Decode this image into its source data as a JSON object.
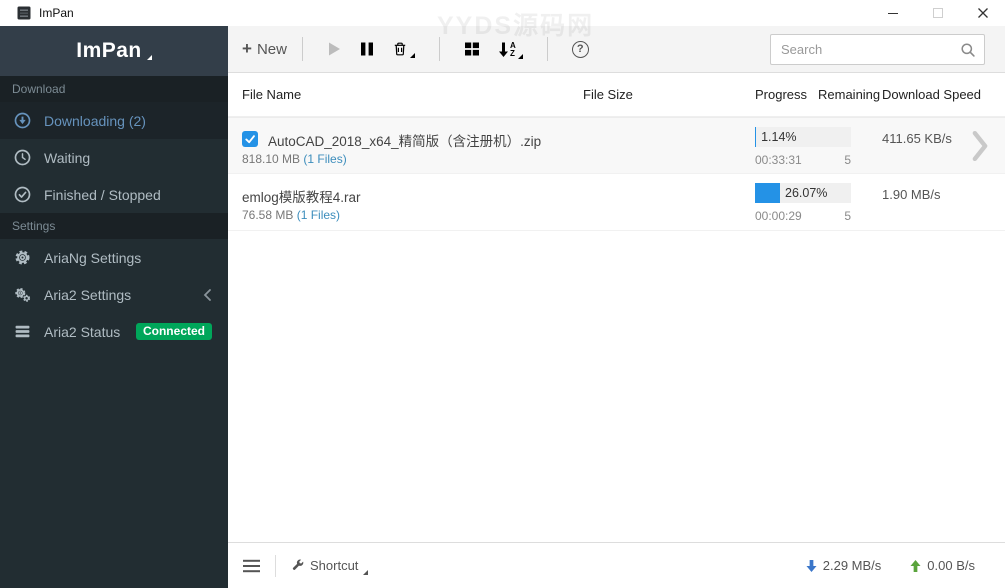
{
  "window": {
    "title": "ImPan"
  },
  "watermark": "YYDS源码网",
  "sidebar": {
    "logo": "ImPan",
    "download_section": {
      "label": "Download",
      "items": [
        {
          "label": "Downloading (2)",
          "icon": "arrow-circle-down-icon",
          "active": true
        },
        {
          "label": "Waiting",
          "icon": "clock-icon"
        },
        {
          "label": "Finished / Stopped",
          "icon": "check-circle-icon"
        }
      ]
    },
    "settings_section": {
      "label": "Settings",
      "items": [
        {
          "label": "AriaNg Settings",
          "icon": "gear-icon"
        },
        {
          "label": "Aria2 Settings",
          "icon": "gears-icon",
          "chevron": "left"
        },
        {
          "label": "Aria2 Status",
          "icon": "server-icon",
          "badge": "Connected"
        }
      ]
    }
  },
  "toolbar": {
    "new_label": "New",
    "search_placeholder": "Search",
    "search_value": ""
  },
  "table": {
    "columns": {
      "name": "File Name",
      "size": "File Size",
      "progress": "Progress",
      "remaining": "Remaining",
      "speed": "Download Speed"
    }
  },
  "downloads": [
    {
      "name": "AutoCAD_2018_x64_精简版（含注册机）.zip",
      "size": "818.10 MB",
      "files_label": "(1 Files)",
      "progress_label": "1.14%",
      "progress_value": 1.14,
      "remaining_time": "00:33:31",
      "connections": "5",
      "speed": "411.65 KB/s",
      "selected": true
    },
    {
      "name": "emlog模版教程4.rar",
      "size": "76.58 MB",
      "files_label": "(1 Files)",
      "progress_label": "26.07%",
      "progress_value": 26.07,
      "remaining_time": "00:00:29",
      "connections": "5",
      "speed": "1.90 MB/s",
      "selected": false
    }
  ],
  "footer": {
    "shortcut_label": "Shortcut",
    "download_speed": "2.29 MB/s",
    "upload_speed": "0.00 B/s"
  },
  "icons": {
    "plus": "+",
    "help": "?",
    "sort_a": "A",
    "sort_z": "Z"
  },
  "colors": {
    "accent_blue": "#2492e6",
    "link_blue": "#3c8dbc",
    "badge_green": "#00a65a",
    "sidebar_bg": "#222d32",
    "active_text": "#6693bd",
    "footer_down_arrow": "#3b76c9",
    "footer_up_arrow": "#5aa43c"
  }
}
